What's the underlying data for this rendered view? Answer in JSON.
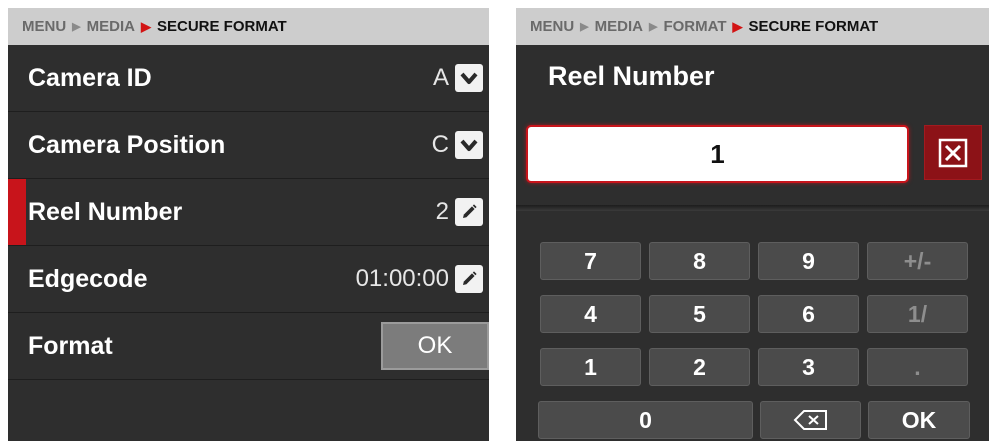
{
  "left": {
    "breadcrumb": {
      "items": [
        "MENU",
        "MEDIA"
      ],
      "current": "SECURE FORMAT"
    },
    "rows": [
      {
        "label": "Camera ID",
        "value": "A",
        "control": "chevron-down-icon"
      },
      {
        "label": "Camera Position",
        "value": "C",
        "control": "chevron-down-icon"
      },
      {
        "label": "Reel Number",
        "value": "2",
        "control": "pencil-icon",
        "selected": true
      },
      {
        "label": "Edgecode",
        "value": "01:00:00",
        "control": "pencil-icon"
      },
      {
        "label": "Format",
        "button": "OK"
      }
    ]
  },
  "right": {
    "breadcrumb": {
      "items": [
        "MENU",
        "MEDIA",
        "FORMAT"
      ],
      "current": "SECURE FORMAT"
    },
    "title": "Reel Number",
    "input_value": "1",
    "keys": {
      "k7": "7",
      "k8": "8",
      "k9": "9",
      "plusminus": "+/-",
      "k4": "4",
      "k5": "5",
      "k6": "6",
      "slash": "1/",
      "k1": "1",
      "k2": "2",
      "k3": "3",
      "dot": ".",
      "k0": "0",
      "ok": "OK"
    }
  },
  "colors": {
    "accent_red": "#c8141b",
    "panel_bg": "#2e2e2e",
    "breadcrumb_bg": "#cdcdcd"
  }
}
